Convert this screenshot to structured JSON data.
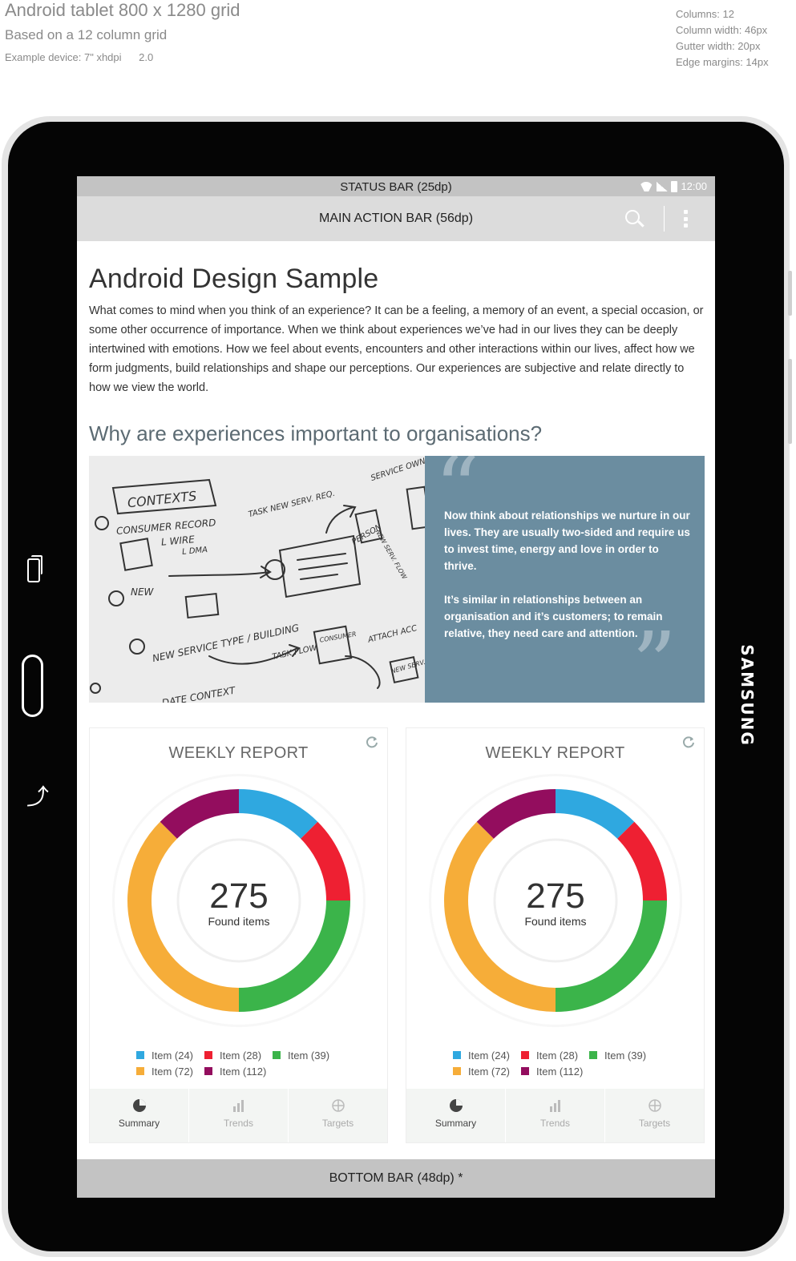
{
  "spec": {
    "title": "Android tablet 800 x 1280 grid",
    "subtitle": "Based on a 12 column grid",
    "device_label": "Example device:  7\"  xhdpi",
    "device_scale": "2.0",
    "columns": "Columns:  12",
    "column_width": "Column width:  46px",
    "gutter_width": "Gutter width:  20px",
    "edge_margins": "Edge margins:  14px"
  },
  "device": {
    "brand": "SAMSUNG",
    "back_glyph": "⤴"
  },
  "status_bar": {
    "label": "STATUS BAR (25dp)",
    "time": "12:00"
  },
  "action_bar": {
    "label": "MAIN ACTION BAR (56dp)"
  },
  "article": {
    "title": "Android Design Sample",
    "intro": "What comes to mind when you think of an experience? It can be a feeling, a memory of an event, a special occasion, or some other occurrence of importance. When we think about experiences we’ve had in our lives they can be deeply intertwined with emotions. How we feel about events, encounters and other interactions within our lives, affect how we form judgments, build relationships and shape our perceptions. Our experiences are subjective and relate directly to how we view the world.",
    "section_title": "Why are experiences important to organisations?"
  },
  "sketch": {
    "contexts": "CONTEXTS",
    "item1": "CONSUMER RECORD",
    "item1b": "L WIRE",
    "item1c": "L DMA",
    "item2": "NEW",
    "item3": "NEW SERVICE TYPE / BUILDING",
    "task_req": "TASK NEW SERV. REQ.",
    "service_owner": "SERVICE OWNER",
    "consumer": "CONSUMER",
    "attach": "ATTACH ACC",
    "task_flow": "TASK FLOW",
    "new_serv": "NEW SERV.",
    "date_context": "DATE CONTEXT",
    "person": "PERSON",
    "new_serv_flow": "NEW SERV. FLOW"
  },
  "quote": {
    "open_mark": "“",
    "close_mark": "”",
    "p1": "Now think about relationships we nurture in our lives. They are usually two-sided and require us to invest time, energy and love in order to thrive.",
    "p2": "It’s similar in relationships between an organisation and it’s customers; to remain relative, they need care and attention."
  },
  "reports": [
    {
      "title": "WEEKLY REPORT",
      "total": "275",
      "total_label": "Found items",
      "legend": [
        "Item (24)",
        "Item (28)",
        "Item (39)",
        "Item (72)",
        "Item (112)"
      ],
      "tabs": [
        "Summary",
        "Trends",
        "Targets"
      ]
    },
    {
      "title": "WEEKLY REPORT",
      "total": "275",
      "total_label": "Found items",
      "legend": [
        "Item (24)",
        "Item (28)",
        "Item (39)",
        "Item (72)",
        "Item (112)"
      ],
      "tabs": [
        "Summary",
        "Trends",
        "Targets"
      ]
    }
  ],
  "chart_data": [
    {
      "type": "pie",
      "title": "WEEKLY REPORT",
      "categories": [
        "Item (24)",
        "Item (28)",
        "Item (39)",
        "Item (72)",
        "Item (112)"
      ],
      "values": [
        24,
        28,
        39,
        72,
        112
      ],
      "colors": [
        "#2fa8e0",
        "#ee2032",
        "#3bb44a",
        "#f6ad39",
        "#930d5e"
      ],
      "center_value": 275,
      "center_label": "Found items",
      "visual_shares": [
        0.125,
        0.125,
        0.25,
        0.375,
        0.125
      ]
    },
    {
      "type": "pie",
      "title": "WEEKLY REPORT",
      "categories": [
        "Item (24)",
        "Item (28)",
        "Item (39)",
        "Item (72)",
        "Item (112)"
      ],
      "values": [
        24,
        28,
        39,
        72,
        112
      ],
      "colors": [
        "#2fa8e0",
        "#ee2032",
        "#3bb44a",
        "#f6ad39",
        "#930d5e"
      ],
      "center_value": 275,
      "center_label": "Found items",
      "visual_shares": [
        0.125,
        0.125,
        0.25,
        0.375,
        0.125
      ]
    }
  ],
  "bottom_bar": {
    "label": "BOTTOM BAR (48dp) *"
  },
  "colors": {
    "quote_bg": "#6b8da0",
    "bars": "#c3c3c3",
    "action_bar": "#dcdcdc",
    "blue": "#2fa8e0",
    "red": "#ee2032",
    "green": "#3bb44a",
    "orange": "#f6ad39",
    "purple": "#930d5e"
  },
  "icons": [
    "wifi-icon",
    "signal-icon",
    "battery-icon",
    "search-icon",
    "overflow-menu-icon",
    "refresh-icon",
    "pie-chart-icon",
    "bar-chart-icon",
    "target-icon",
    "recent-apps-icon",
    "home-icon",
    "back-icon"
  ]
}
